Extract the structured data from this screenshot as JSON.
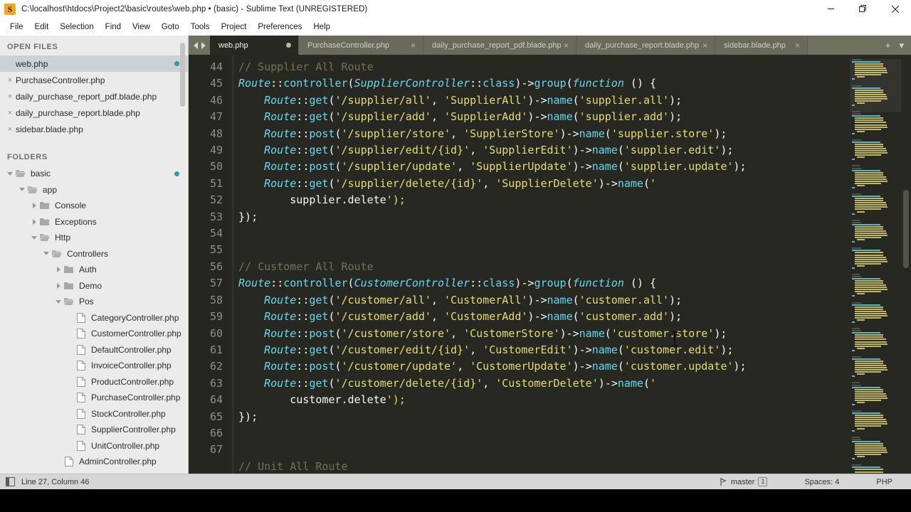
{
  "window": {
    "title": "C:\\localhost\\htdocs\\Project2\\basic\\routes\\web.php • (basic) - Sublime Text (UNREGISTERED)",
    "app_icon_letter": "S",
    "accent_color": "#f5a623",
    "controls": {
      "minimize": "minimize-icon",
      "maximize": "restore-icon",
      "close": "close-icon"
    }
  },
  "menubar": {
    "items": [
      "File",
      "Edit",
      "Selection",
      "Find",
      "View",
      "Goto",
      "Tools",
      "Project",
      "Preferences",
      "Help"
    ]
  },
  "sidebar": {
    "open_files_header": "OPEN FILES",
    "folders_header": "FOLDERS",
    "open_files": [
      {
        "label": "web.php",
        "active": true,
        "modified": true
      },
      {
        "label": "PurchaseController.php",
        "active": false,
        "modified": false
      },
      {
        "label": "daily_purchase_report_pdf.blade.php",
        "active": false,
        "modified": false
      },
      {
        "label": "daily_purchase_report.blade.php",
        "active": false,
        "modified": false
      },
      {
        "label": "sidebar.blade.php",
        "active": false,
        "modified": false
      }
    ],
    "tree": [
      {
        "label": "basic",
        "type": "folder",
        "state": "open",
        "depth": 0,
        "modified": true
      },
      {
        "label": "app",
        "type": "folder",
        "state": "open",
        "depth": 1,
        "modified": false
      },
      {
        "label": "Console",
        "type": "folder",
        "state": "closed",
        "depth": 2,
        "modified": false
      },
      {
        "label": "Exceptions",
        "type": "folder",
        "state": "closed",
        "depth": 2,
        "modified": false
      },
      {
        "label": "Http",
        "type": "folder",
        "state": "open",
        "depth": 2,
        "modified": false
      },
      {
        "label": "Controllers",
        "type": "folder",
        "state": "open",
        "depth": 3,
        "modified": false
      },
      {
        "label": "Auth",
        "type": "folder",
        "state": "closed",
        "depth": 4,
        "modified": false
      },
      {
        "label": "Demo",
        "type": "folder",
        "state": "closed",
        "depth": 4,
        "modified": false
      },
      {
        "label": "Pos",
        "type": "folder",
        "state": "open",
        "depth": 4,
        "modified": false
      },
      {
        "label": "CategoryController.php",
        "type": "file",
        "state": "none",
        "depth": 5,
        "modified": false
      },
      {
        "label": "CustomerController.php",
        "type": "file",
        "state": "none",
        "depth": 5,
        "modified": false
      },
      {
        "label": "DefaultController.php",
        "type": "file",
        "state": "none",
        "depth": 5,
        "modified": false
      },
      {
        "label": "InvoiceController.php",
        "type": "file",
        "state": "none",
        "depth": 5,
        "modified": false
      },
      {
        "label": "ProductController.php",
        "type": "file",
        "state": "none",
        "depth": 5,
        "modified": false
      },
      {
        "label": "PurchaseController.php",
        "type": "file",
        "state": "none",
        "depth": 5,
        "modified": false
      },
      {
        "label": "StockController.php",
        "type": "file",
        "state": "none",
        "depth": 5,
        "modified": false
      },
      {
        "label": "SupplierController.php",
        "type": "file",
        "state": "none",
        "depth": 5,
        "modified": false
      },
      {
        "label": "UnitController.php",
        "type": "file",
        "state": "none",
        "depth": 5,
        "modified": false
      },
      {
        "label": "AdminController.php",
        "type": "file",
        "state": "none",
        "depth": 4,
        "modified": false
      }
    ]
  },
  "tabs": {
    "items": [
      {
        "label": "web.php",
        "active": true,
        "modified": true
      },
      {
        "label": "PurchaseController.php",
        "active": false,
        "modified": false
      },
      {
        "label": "daily_purchase_report_pdf.blade.php",
        "active": false,
        "modified": false
      },
      {
        "label": "daily_purchase_report.blade.php",
        "active": false,
        "modified": false
      },
      {
        "label": "sidebar.blade.php",
        "active": false,
        "modified": false
      }
    ],
    "new_tab_label": "+",
    "overflow_label": "▾"
  },
  "editor": {
    "language": "PHP",
    "first_line_number": 44,
    "line_numbers": [
      44,
      45,
      46,
      47,
      48,
      49,
      50,
      51,
      52,
      53,
      54,
      55,
      56,
      57,
      58,
      59,
      60,
      61,
      62,
      63,
      64,
      65,
      66,
      67
    ],
    "lines": [
      "// Supplier All Route",
      "Route::controller(SupplierController::class)->group(function () {",
      "    Route::get('/supplier/all', 'SupplierAll')->name('supplier.all');",
      "    Route::get('/supplier/add', 'SupplierAdd')->name('supplier.add');",
      "    Route::post('/supplier/store', 'SupplierStore')->name('supplier.store');",
      "    Route::get('/supplier/edit/{id}', 'SupplierEdit')->name('supplier.edit');",
      "    Route::post('/supplier/update', 'SupplierUpdate')->name('supplier.update');",
      "    Route::get('/supplier/delete/{id}', 'SupplierDelete')->name('",
      "        supplier.delete');",
      "});",
      "",
      "",
      "// Customer All Route",
      "Route::controller(CustomerController::class)->group(function () {",
      "    Route::get('/customer/all', 'CustomerAll')->name('customer.all');",
      "    Route::get('/customer/add', 'CustomerAdd')->name('customer.add');",
      "    Route::post('/customer/store', 'CustomerStore')->name('customer.store');",
      "    Route::get('/customer/edit/{id}', 'CustomerEdit')->name('customer.edit');",
      "    Route::post('/customer/update', 'CustomerUpdate')->name('customer.update');",
      "    Route::get('/customer/delete/{id}', 'CustomerDelete')->name('",
      "        customer.delete');",
      "});",
      "",
      "",
      "// Unit All Route"
    ],
    "colors": {
      "background": "#272822",
      "gutter_background": "#252620",
      "comment": "#75715e",
      "class": "#66d9ef",
      "function": "#66d9ef",
      "string": "#e6db74",
      "plain": "#f8f8f2",
      "line_number": "#8f908a"
    }
  },
  "statusbar": {
    "cursor_position": "Line 27, Column 46",
    "branch": "master",
    "branch_count": "1",
    "indentation": "Spaces: 4",
    "syntax": "PHP"
  }
}
